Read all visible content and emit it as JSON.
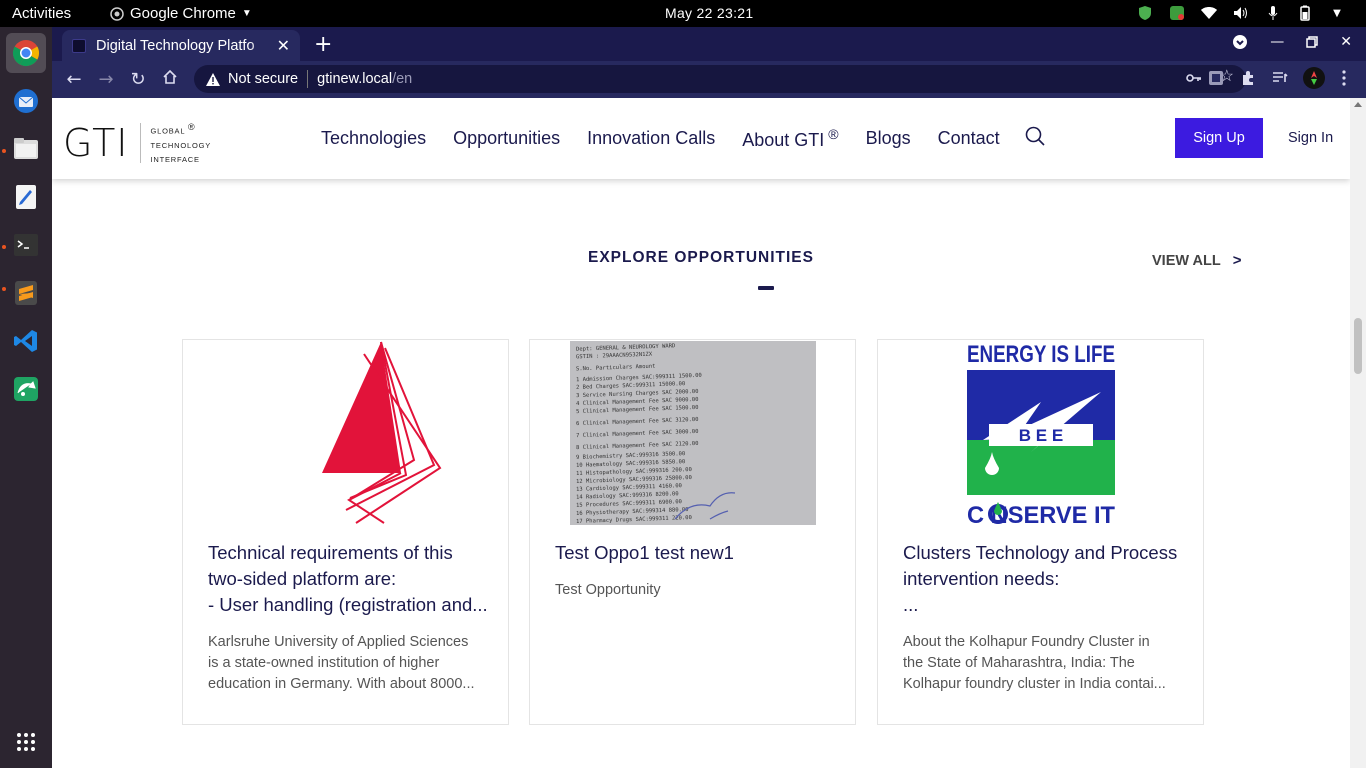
{
  "system": {
    "activities": "Activities",
    "app_name": "Google Chrome",
    "clock": "May 22  23:21"
  },
  "browser": {
    "tab_title": "Digital Technology Platfo",
    "security_label": "Not secure",
    "url_host": "gtinew.local",
    "url_path": "/en"
  },
  "header": {
    "logo_text": "GTI",
    "logo_sub": [
      "GLOBAL",
      "TECHNOLOGY",
      "INTERFACE"
    ],
    "logo_reg": "®",
    "nav": [
      "Technologies",
      "Opportunities",
      "Innovation Calls",
      "About GTI",
      "Blogs",
      "Contact"
    ],
    "about_reg": "®",
    "signup": "Sign Up",
    "signin": "Sign In"
  },
  "section": {
    "title": "EXPLORE OPPORTUNITIES",
    "view_all": "VIEW ALL",
    "view_all_chevron": ">"
  },
  "cards": [
    {
      "title_lines": [
        "Technical requirements of this",
        "two-sided platform are:",
        "- User handling (registration and..."
      ],
      "desc_lines": [
        "Karlsruhe University of Applied Sciences",
        "is a state-owned institution of higher",
        "education in Germany. With about 8000..."
      ]
    },
    {
      "title_lines": [
        "Test Oppo1 test new1"
      ],
      "desc_lines": [
        "Test Opportunity"
      ]
    },
    {
      "title_lines": [
        "Clusters Technology and Process",
        "intervention needs:",
        "..."
      ],
      "desc_lines": [
        "About the Kolhapur Foundry Cluster in",
        "the State of Maharashtra, India: The",
        "Kolhapur foundry cluster in India contai..."
      ]
    }
  ],
  "energy_logo": {
    "top": "ENERGY IS LIFE",
    "middle": "B E E",
    "bottom": "C  NSERVE IT"
  },
  "colors": {
    "brand_dark": "#1b1a4d",
    "signup_bg": "#3c1be0",
    "red_logo": "#e2133a",
    "bee_blue": "#1f2aa6",
    "bee_green": "#21b24b"
  }
}
